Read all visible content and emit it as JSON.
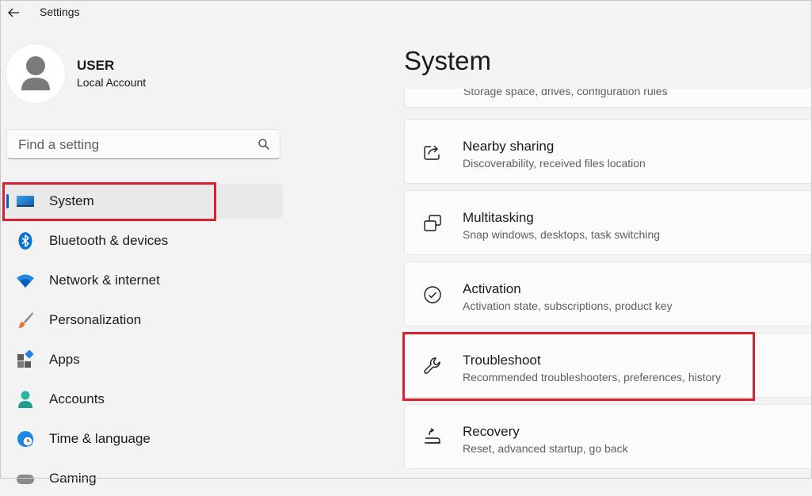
{
  "window": {
    "title": "Settings"
  },
  "profile": {
    "name": "USER",
    "account_type": "Local Account"
  },
  "search": {
    "placeholder": "Find a setting",
    "value": ""
  },
  "nav": {
    "items": [
      {
        "label": "System",
        "icon": "system-icon",
        "selected": true
      },
      {
        "label": "Bluetooth & devices",
        "icon": "bluetooth-icon"
      },
      {
        "label": "Network & internet",
        "icon": "wifi-icon"
      },
      {
        "label": "Personalization",
        "icon": "brush-icon"
      },
      {
        "label": "Apps",
        "icon": "apps-icon"
      },
      {
        "label": "Accounts",
        "icon": "person-icon"
      },
      {
        "label": "Time & language",
        "icon": "clock-globe-icon"
      },
      {
        "label": "Gaming",
        "icon": "controller-icon"
      }
    ]
  },
  "main": {
    "title": "System",
    "partial_item_subtitle": "Storage space, drives, configuration rules",
    "items": [
      {
        "title": "Nearby sharing",
        "subtitle": "Discoverability, received files location",
        "icon": "share-icon"
      },
      {
        "title": "Multitasking",
        "subtitle": "Snap windows, desktops, task switching",
        "icon": "multitasking-icon"
      },
      {
        "title": "Activation",
        "subtitle": "Activation state, subscriptions, product key",
        "icon": "check-circle-icon"
      },
      {
        "title": "Troubleshoot",
        "subtitle": "Recommended troubleshooters, preferences, history",
        "icon": "wrench-icon"
      },
      {
        "title": "Recovery",
        "subtitle": "Reset, advanced startup, go back",
        "icon": "recovery-icon"
      }
    ]
  },
  "colors": {
    "accent": "#005fb8",
    "highlight": "#d92030",
    "background": "#f3f3f3",
    "card": "#fbfbfb"
  }
}
